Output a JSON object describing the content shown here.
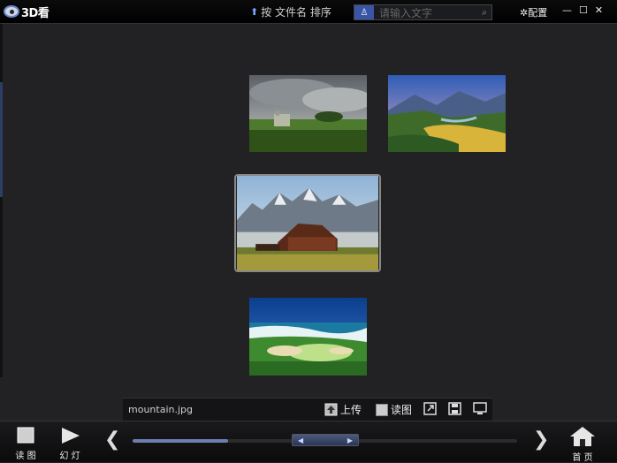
{
  "app": {
    "logo_text": "3D看"
  },
  "titlebar": {
    "sort_label": "按 文件名 排序",
    "search_placeholder": "请输入文字",
    "config_label": "配置",
    "minimize": "—",
    "maximize": "☐",
    "close": "✕"
  },
  "info_bar": {
    "filename": "mountain.jpg",
    "upload_label": "上传",
    "read_label": "读图"
  },
  "bottom_bar": {
    "read_label": "读 图",
    "slideshow_label": "幻 灯",
    "home_label": "首 页",
    "prev": "❮",
    "next": "❯"
  }
}
